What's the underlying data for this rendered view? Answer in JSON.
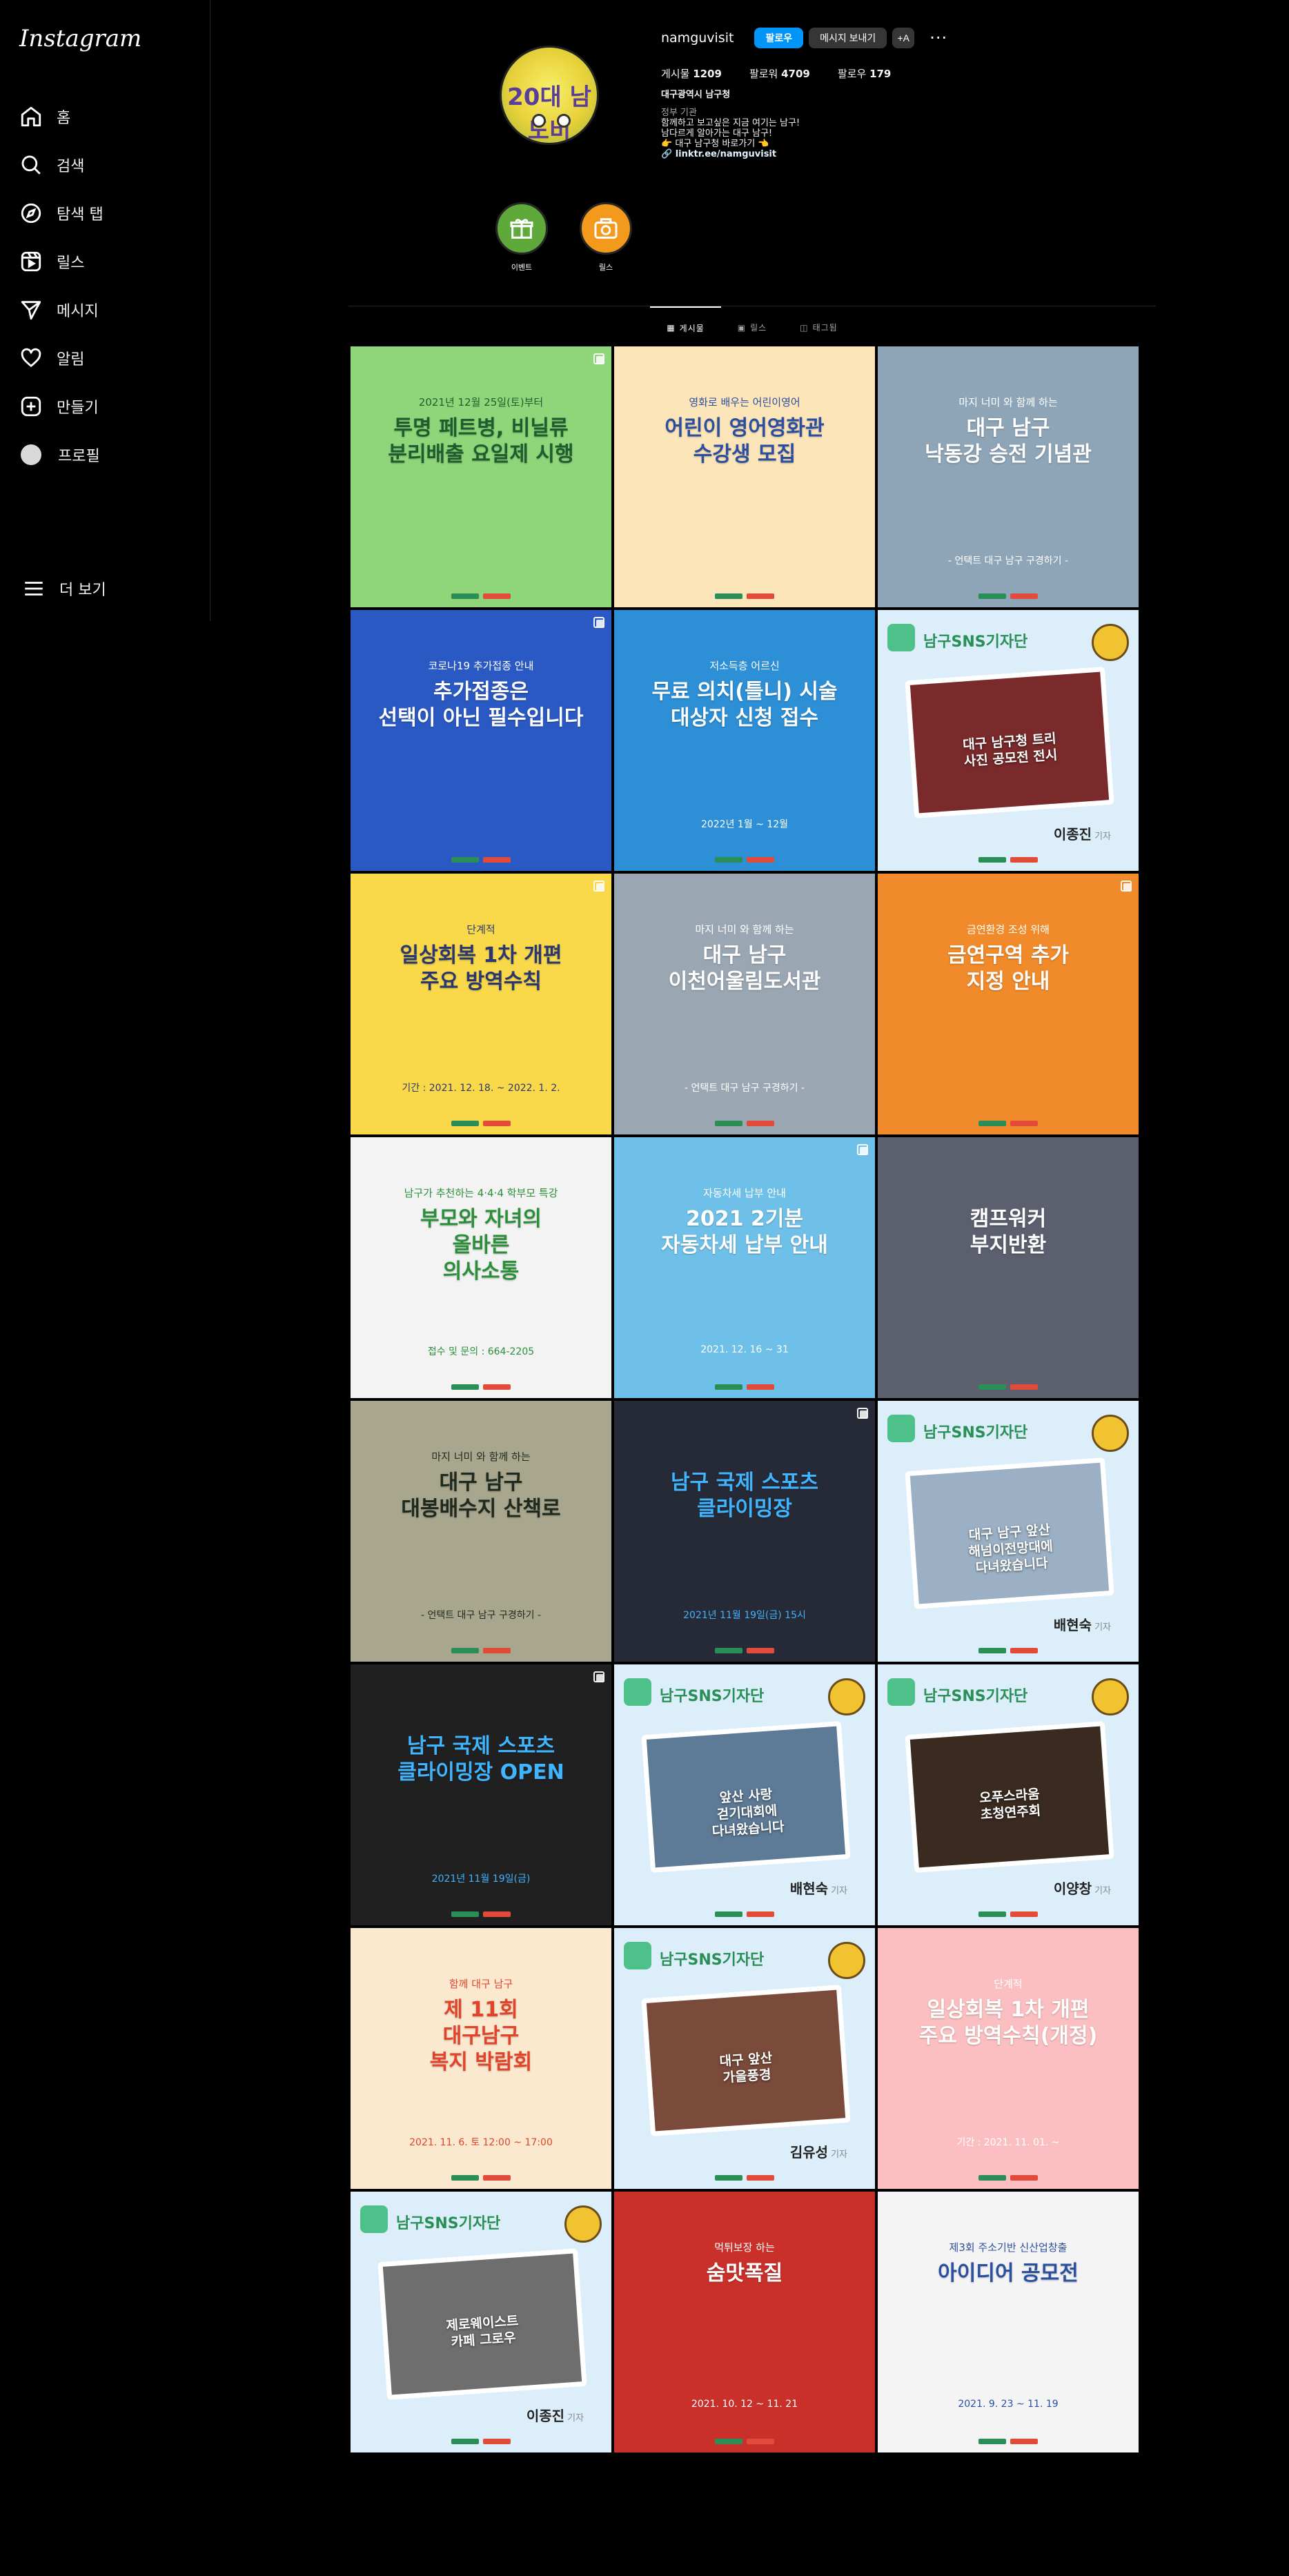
{
  "app": {
    "logo": "Instagram"
  },
  "sidebar": {
    "items": [
      {
        "label": "홈",
        "icon": "home-icon"
      },
      {
        "label": "검색",
        "icon": "search-icon"
      },
      {
        "label": "탐색 탭",
        "icon": "compass-icon"
      },
      {
        "label": "릴스",
        "icon": "reels-icon"
      },
      {
        "label": "메시지",
        "icon": "paper-plane-icon"
      },
      {
        "label": "알림",
        "icon": "heart-icon"
      },
      {
        "label": "만들기",
        "icon": "plus-square-icon"
      },
      {
        "label": "프로필",
        "icon": "avatar-icon"
      }
    ],
    "more": "더 보기"
  },
  "profile": {
    "username": "namguvisit",
    "follow_button": "팔로우",
    "message_button": "메시지 보내기",
    "add_person_button": "+A",
    "stats": {
      "posts_label": "게시물",
      "posts": "1209",
      "followers_label": "팔로워",
      "followers": "4709",
      "following_label": "팔로우",
      "following": "179"
    },
    "full_name": "대구광역시 남구청",
    "category": "정부 기관",
    "bio_line1": "함께하고 보고싶은 지금 여기는 남구!",
    "bio_line2": "남다르게 알아가는 대구 남구!",
    "bio_line3": "👉 대구 남구청 바로가기 👈",
    "link": "linktr.ee/namguvisit",
    "avatar_text": "20대 남도비"
  },
  "highlights": [
    {
      "label": "이벤트",
      "color": "#5fa83a",
      "icon": "gift-icon"
    },
    {
      "label": "릴스",
      "color": "#f39a1d",
      "icon": "camera-icon"
    }
  ],
  "tabs": [
    {
      "label": "게시물",
      "icon": "grid-icon",
      "active": true
    },
    {
      "label": "릴스",
      "icon": "reels-icon",
      "active": false
    },
    {
      "label": "태그됨",
      "icon": "tag-icon",
      "active": false
    }
  ],
  "posts": [
    {
      "bg": "#8fd67a",
      "fg": "#1e5e2e",
      "t1": "2021년 12월 25일(토)부터",
      "t2": "투명 페트병, 비닐류\n분리배출 요일제 시행",
      "t3": "",
      "multi": true
    },
    {
      "bg": "#fce5b8",
      "fg": "#2b4ea0",
      "t1": "영화로 배우는 어린이영어",
      "t2": "어린이 영어영화관\n수강생 모집",
      "t3": "",
      "multi": false
    },
    {
      "bg": "#8ea5b7",
      "fg": "#ffffff",
      "t1": "마지 너미 와 함께 하는",
      "t2": "대구 남구\n낙동강 승전 기념관",
      "t3": "- 언택트 대구 남구 구경하기 -",
      "multi": false
    },
    {
      "bg": "#2b59c3",
      "fg": "#ffffff",
      "t1": "코로나19 추가접종 안내",
      "t2": "추가접종은\n선택이 아닌 필수입니다",
      "t3": "",
      "multi": true
    },
    {
      "bg": "#2d8fd6",
      "fg": "#ffffff",
      "t1": "저소득층 어르신",
      "t2": "무료 의치(틀니) 시술\n대상자 신청 접수",
      "t3": "2022년 1월 ~ 12월",
      "multi": false
    },
    {
      "bg": "#dbeefa",
      "fg": "#2a8f56",
      "sns": true,
      "caption": "대구 남구청 트리\n사진 공모전 전시",
      "reporter": "이종진",
      "photo": "#7a2a2a"
    },
    {
      "bg": "#f9d94a",
      "fg": "#2a3670",
      "t1": "단계적",
      "t2": "일상회복 1차 개편\n주요 방역수칙",
      "t3": "기간 : 2021. 12. 18. ~ 2022. 1. 2.",
      "multi": true
    },
    {
      "bg": "#9aa7b3",
      "fg": "#ffffff",
      "t1": "마지 너미 와 함께 하는",
      "t2": "대구 남구\n이천어울림도서관",
      "t3": "- 언택트 대구 남구 구경하기 -",
      "multi": false
    },
    {
      "bg": "#f08a2a",
      "fg": "#ffffff",
      "t1": "금연환경 조성 위해",
      "t2": "금연구역 추가\n지정 안내",
      "t3": "",
      "multi": true
    },
    {
      "bg": "#f3f3f3",
      "fg": "#2b8f3a",
      "t1": "남구가 추천하는 4·4·4 학부모 특강",
      "t2": "부모와 자녀의\n올바른\n의사소통",
      "t3": "접수 및 문의 : 664-2205",
      "multi": false
    },
    {
      "bg": "#6fc0e8",
      "fg": "#ffffff",
      "t1": "자동차세 납부 안내",
      "t2": "2021 2기분\n자동차세 납부 안내",
      "t3": "2021. 12. 16 ~ 31",
      "multi": true
    },
    {
      "bg": "#5b5f6e",
      "fg": "#ffffff",
      "t1": "",
      "t2": "캠프워커\n부지반환",
      "t3": "",
      "multi": false
    },
    {
      "bg": "#a9a68e",
      "fg": "#1f2a1f",
      "t1": "마지 너미 와 함께 하는",
      "t2": "대구 남구\n대봉배수지 산책로",
      "t3": "- 언택트 대구 남구 구경하기 -",
      "multi": false
    },
    {
      "bg": "#262a36",
      "fg": "#3fb4ff",
      "t1": "",
      "t2": "남구 국제 스포츠\n클라이밍장",
      "t3": "2021년 11월 19일(금) 15시",
      "multi": true
    },
    {
      "bg": "#dbeefa",
      "fg": "#2a8f56",
      "sns": true,
      "caption": "대구 남구 앞산\n해넘이전망대에\n다녀왔습니다",
      "reporter": "배현숙",
      "photo": "#9bb0c4"
    },
    {
      "bg": "#202020",
      "fg": "#3fb4ff",
      "t1": "",
      "t2": "남구 국제 스포츠\n클라이밍장 OPEN",
      "t3": "2021년 11월 19일(금)",
      "multi": true
    },
    {
      "bg": "#dbeefa",
      "fg": "#2a8f56",
      "sns": true,
      "caption": "앞산 사랑\n걷기대회에\n다녀왔습니다",
      "reporter": "배현숙",
      "photo": "#5d7a96"
    },
    {
      "bg": "#dbeefa",
      "fg": "#2a8f56",
      "sns": true,
      "caption": "오푸스라움\n초청연주회",
      "reporter": "이양창",
      "photo": "#3a2a20"
    },
    {
      "bg": "#fbe9cf",
      "fg": "#e2432a",
      "t1": "함께 대구 남구",
      "t2": "제 11회\n대구남구\n복지 박람회",
      "t3": "2021. 11. 6. 토 12:00 ~ 17:00",
      "multi": false
    },
    {
      "bg": "#dbeefa",
      "fg": "#2a8f56",
      "sns": true,
      "caption": "대구 앞산\n가을풍경",
      "reporter": "김유성",
      "photo": "#7a4a3a"
    },
    {
      "bg": "#fbbfc1",
      "fg": "#ffffff",
      "t1": "단계적",
      "t2": "일상회복 1차 개편\n주요 방역수칙(개정)",
      "t3": "기간 : 2021. 11. 01. ~",
      "multi": false
    },
    {
      "bg": "#dbeefa",
      "fg": "#2a8f56",
      "sns": true,
      "caption": "제로웨이스트\n카페 그로우",
      "reporter": "이종진",
      "photo": "#6e6e6e"
    },
    {
      "bg": "#c9302a",
      "fg": "#ffffff",
      "t1": "먹튀보장 하는",
      "t2": "숨맛폭질",
      "t3": "2021. 10. 12 ~ 11. 21",
      "multi": false
    },
    {
      "bg": "#f4f4f4",
      "fg": "#2a4fa0",
      "t1": "제3회 주소기반 신산업창출",
      "t2": "아이디어 공모전",
      "t3": "2021. 9. 23 ~ 11. 19",
      "multi": false
    }
  ],
  "colors": {
    "accent": "#0095f6",
    "background": "#000000",
    "border": "#262626"
  }
}
